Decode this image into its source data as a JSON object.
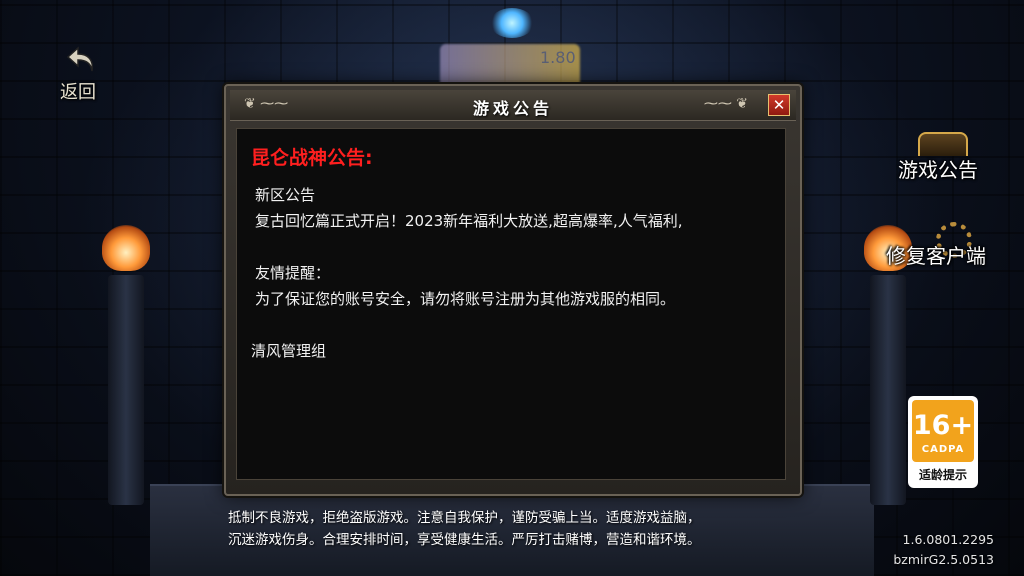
{
  "back": {
    "label": "返回",
    "icon": "back-arrow-icon"
  },
  "background": {
    "version_overlay": "1.80"
  },
  "dialog": {
    "title": "游戏公告",
    "close_symbol": "✕",
    "heading": "昆仑战神公告:",
    "lines": [
      "新区公告",
      "复古回忆篇正式开启！2023新年福利大放送,超高爆率,人气福利,",
      "友情提醒：",
      "为了保证您的账号安全，请勿将账号注册为其他游戏服的相同。"
    ],
    "signature": "清风管理组"
  },
  "side_buttons": {
    "notice_label": "游戏公告",
    "repair_label": "修复客户端"
  },
  "age_badge": {
    "age": "16+",
    "org": "CADPA",
    "hint": "适龄提示",
    "color": "#f2a31c"
  },
  "footer": {
    "tip_line1": "抵制不良游戏，拒绝盗版游戏。注意自我保护，谨防受骗上当。适度游戏益脑，",
    "tip_line2": "沉迷游戏伤身。合理安排时间，享受健康生活。严厉打击赌博，营造和谐环境。",
    "version1": "1.6.0801.2295",
    "version2": "bzmirG2.5.0513"
  }
}
